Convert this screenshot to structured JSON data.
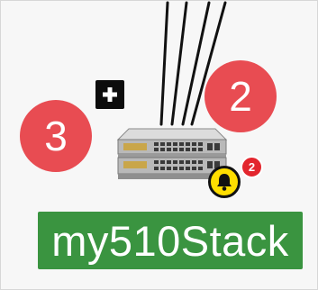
{
  "node": {
    "name": "my510Stack",
    "neighbor_badges": {
      "top_right": "2",
      "left": "3"
    },
    "expand_symbol": "+",
    "alarm_count": "2"
  },
  "icons": {
    "device": "stacked-network-switch-icon",
    "expand": "plus-icon",
    "alarm": "bell-icon"
  },
  "colors": {
    "label_bg": "#3a9440",
    "badge_bg": "#e84c52",
    "alarm_bg": "#ffde00",
    "alarm_count_bg": "#e3262e"
  }
}
